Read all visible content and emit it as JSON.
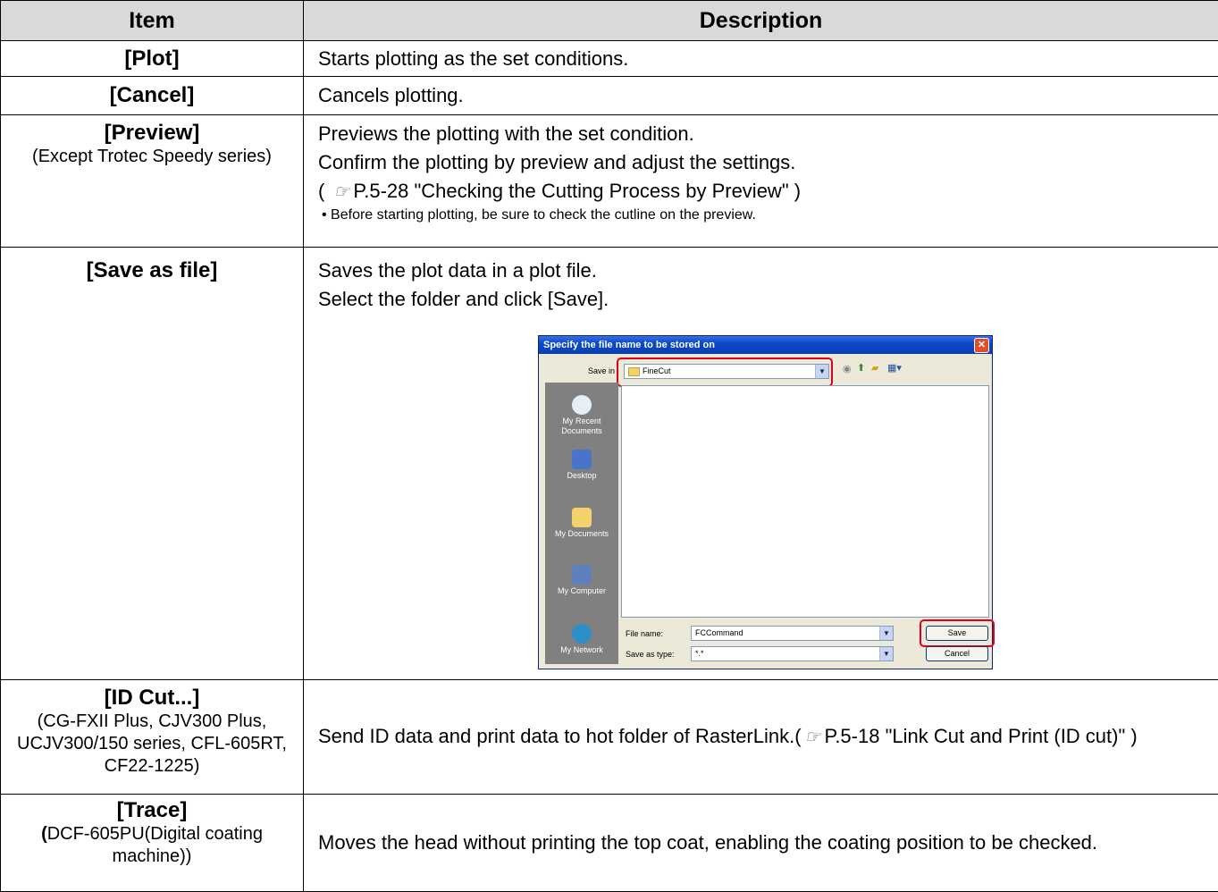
{
  "headers": {
    "item": "Item",
    "description": "Description"
  },
  "rows": [
    {
      "item": "[Plot]",
      "desc": [
        "Starts plotting as the set conditions."
      ]
    },
    {
      "item": "[Cancel]",
      "desc": [
        "Cancels plotting."
      ]
    },
    {
      "item": "[Preview]",
      "note": "(Except Trotec Speedy series)",
      "desc": [
        "Previews the plotting with the set condition.",
        "Confirm the plotting by preview and adjust the settings."
      ],
      "ref": "P.5-28 \"Checking the Cutting Process by Preview\" )",
      "bullet": "• Before starting plotting, be sure to check the cutline on the preview."
    },
    {
      "item": "[Save as file]",
      "desc": [
        "Saves the plot data in a plot file.",
        "Select the folder and click [Save]."
      ]
    },
    {
      "item": "[ID Cut...]",
      "note": "(CG-FXII Plus, CJV300 Plus, UCJV300/150 series, CFL-605RT, CF22-1225)",
      "desc_pre": "Send ID data and print data to hot folder of RasterLink.(",
      "desc_ref": "P.5-18 \"Link Cut and Print (ID cut)\" )"
    },
    {
      "item": "[Trace]",
      "note_bold": "(",
      "note": "DCF-605PU(Digital coating machine))",
      "desc": [
        "Moves the head without printing the top coat, enabling the coating position to be checked."
      ]
    }
  ],
  "dialog": {
    "title": "Specify the file name to be stored on",
    "save_in_label": "Save in",
    "save_in_value": "FineCut",
    "places": [
      "My Recent Documents",
      "Desktop",
      "My Documents",
      "My Computer",
      "My Network"
    ],
    "file_name_label": "File name:",
    "file_name_value": "FCCommand",
    "save_type_label": "Save as type:",
    "save_type_value": "*.*",
    "save_button": "Save",
    "cancel_button": "Cancel"
  }
}
